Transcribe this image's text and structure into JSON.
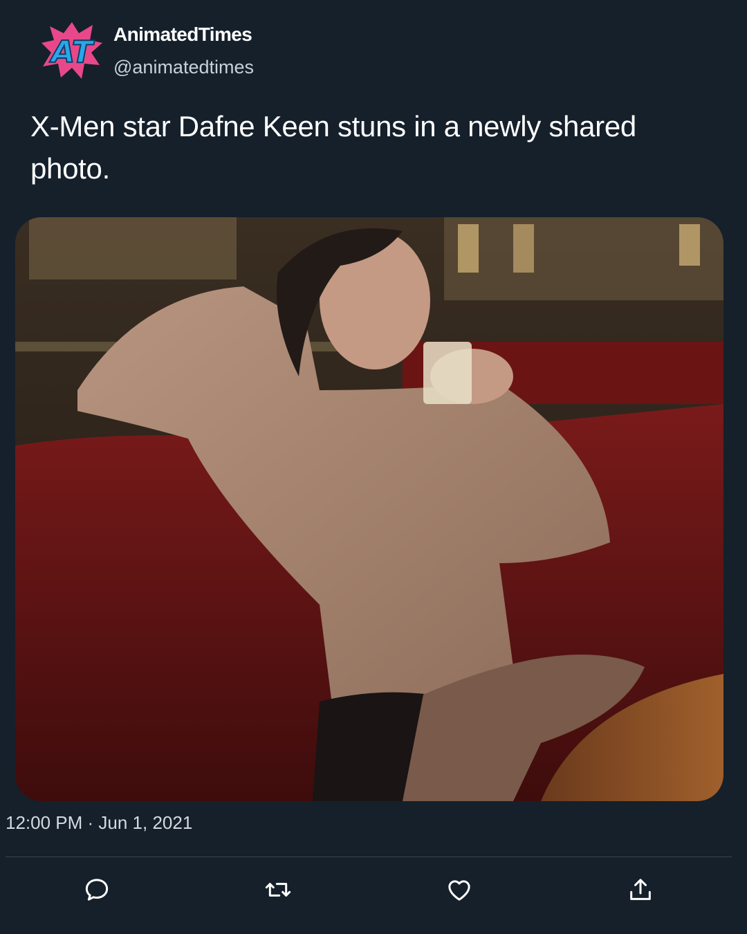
{
  "tweet": {
    "author_name": "AnimatedTimes",
    "author_handle": "@animatedtimes",
    "avatar_text": "AT",
    "text": "X-Men star Dafne Keen stuns in a newly shared photo.",
    "timestamp": "12:00 PM · Jun 1, 2021"
  },
  "actions": [
    {
      "icon": "reply-icon"
    },
    {
      "icon": "retweet-icon"
    },
    {
      "icon": "like-icon"
    },
    {
      "icon": "share-icon"
    }
  ],
  "colors": {
    "background": "#15202b",
    "text": "#ffffff",
    "secondary_text": "#c9d1d9",
    "divider": "#38444d",
    "avatar_blue": "#2aa7e8",
    "avatar_pink": "#e8488a"
  }
}
